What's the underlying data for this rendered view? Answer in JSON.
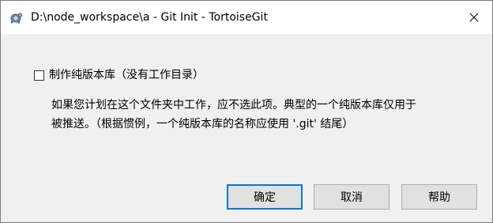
{
  "window": {
    "title": "D:\\node_workspace\\a - Git Init - TortoiseGit",
    "icon": "tortoisegit-icon",
    "close_icon": "close-icon"
  },
  "options": {
    "bare_repo_checkbox": {
      "label": "制作纯版本库（没有工作目录）",
      "checked": false
    }
  },
  "description": {
    "line1": "如果您计划在这个文件夹中工作，应不选此项。典型的一个纯版本库仅用于",
    "line2": "被推送。（根据惯例，一个纯版本库的名称应使用 '.git' 结尾）"
  },
  "buttons": {
    "ok": "确定",
    "cancel": "取消",
    "help": "帮助"
  },
  "colors": {
    "accent": "#0078d7",
    "dialog_bg": "#f0f0f0",
    "button_bg": "#e1e1e1"
  }
}
